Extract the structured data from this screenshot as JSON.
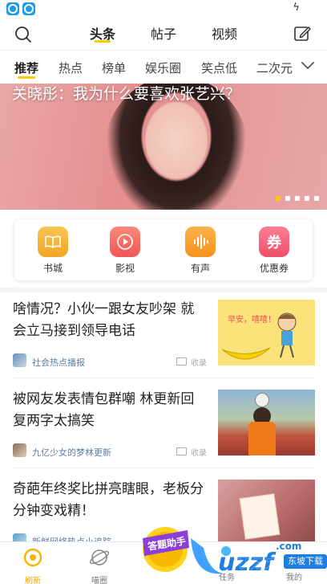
{
  "header": {
    "tabs": [
      {
        "label": "头条",
        "active": true
      },
      {
        "label": "帖子",
        "active": false
      },
      {
        "label": "视频",
        "active": false
      }
    ]
  },
  "categories": [
    {
      "label": "推荐",
      "active": true
    },
    {
      "label": "热点"
    },
    {
      "label": "榜单"
    },
    {
      "label": "娱乐圈"
    },
    {
      "label": "笑点低"
    },
    {
      "label": "二次元"
    }
  ],
  "banner": {
    "title": "关晓彤：我为什么要喜欢张艺兴？",
    "slides": 5,
    "current": 1
  },
  "quick_entries": [
    {
      "label": "书城",
      "icon": "book-icon",
      "color": "#f5a623",
      "glyph": "📖"
    },
    {
      "label": "影视",
      "icon": "play-icon",
      "color": "#f05a5a",
      "glyph": "▶"
    },
    {
      "label": "有声",
      "icon": "audio-wave-icon",
      "color": "#f7931e",
      "glyph": "|||"
    },
    {
      "label": "优惠券",
      "icon": "coupon-icon",
      "color": "#f2576a",
      "glyph": "券"
    }
  ],
  "news": [
    {
      "title": "啥情况？小伙一跟女友吵架 就会立马接到领导电话",
      "source": "社会热点播报",
      "action": "收录",
      "thumb_text": "早安，嘻嘻！"
    },
    {
      "title": "被网友发表情包群嘲 林更新回复两字太搞笑",
      "source": "九亿少女的梦林更新",
      "action": "收录"
    },
    {
      "title": "奇葩年终奖比拼亮瞎眼，老板分分钟变戏精！",
      "source": "新鲜网络热点小追踪",
      "action": "收录"
    }
  ],
  "floater": {
    "label": "答题助手"
  },
  "watermark": {
    "logo": "uzzf",
    "caption": "东坡下载"
  },
  "bottom_nav": [
    {
      "label": "刷新",
      "active": true
    },
    {
      "label": "喵圈"
    },
    {
      "label": ""
    },
    {
      "label": "任务"
    },
    {
      "label": "我的"
    }
  ]
}
